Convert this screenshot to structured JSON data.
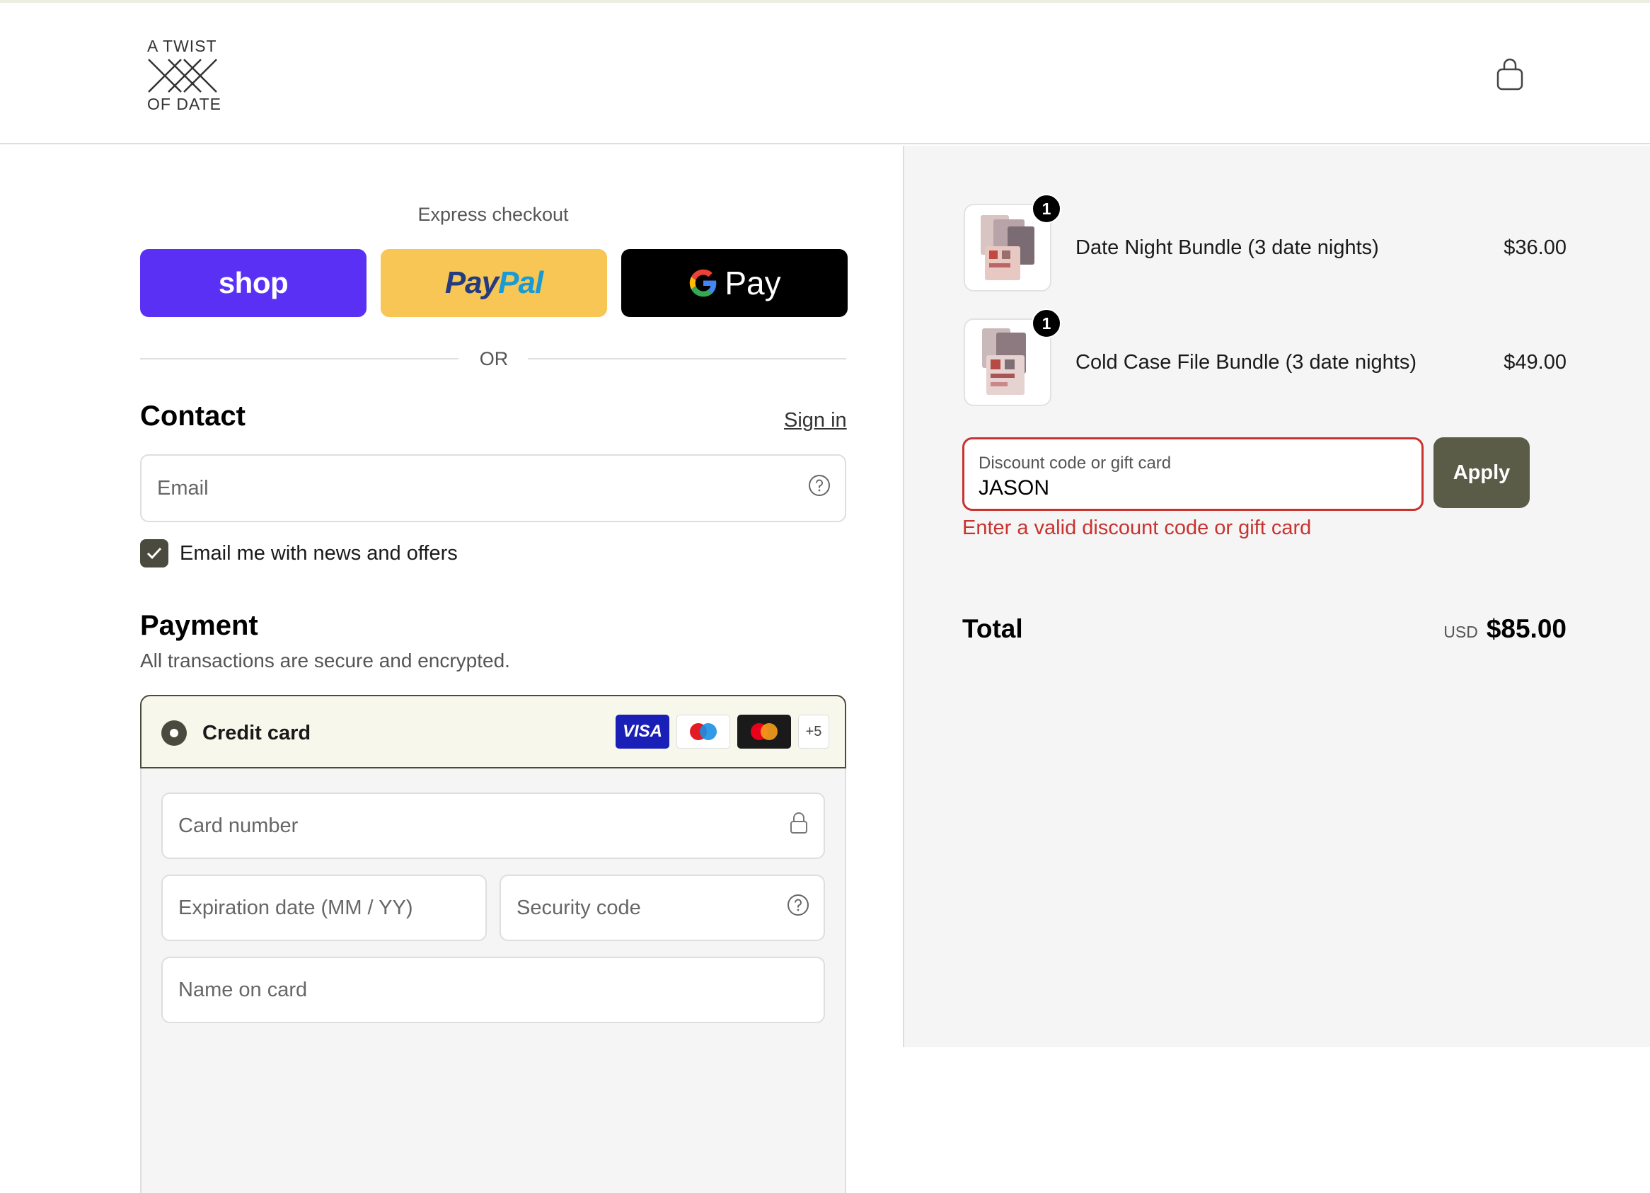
{
  "brand": {
    "logo_line1": "A TWIST",
    "logo_line2": "OF DATE"
  },
  "header": {
    "cart_icon": "shopping-bag-icon"
  },
  "express": {
    "title": "Express checkout",
    "shop_label": "shop",
    "paypal_part1": "Pay",
    "paypal_part2": "Pal",
    "gpay_label": "Pay",
    "or_label": "OR"
  },
  "contact": {
    "title": "Contact",
    "sign_in": "Sign in",
    "email_placeholder": "Email",
    "newsletter_label": "Email me with news and offers",
    "newsletter_checked": true
  },
  "payment": {
    "title": "Payment",
    "subtitle": "All transactions are secure and encrypted.",
    "method_label": "Credit card",
    "card_brands": [
      "VISA",
      "maestro",
      "mastercard"
    ],
    "more_brands": "+5",
    "card_number_placeholder": "Card number",
    "expiry_placeholder": "Expiration date (MM / YY)",
    "security_placeholder": "Security code",
    "name_placeholder": "Name on card"
  },
  "order": {
    "items": [
      {
        "name": "Date Night Bundle (3 date nights)",
        "price": "$36.00",
        "qty": "1"
      },
      {
        "name": "Cold Case File Bundle (3 date nights)",
        "price": "$49.00",
        "qty": "1"
      }
    ],
    "discount_label": "Discount code or gift card",
    "discount_value": "JASON",
    "apply_label": "Apply",
    "discount_error": "Enter a valid discount code or gift card",
    "total_label": "Total",
    "currency": "USD",
    "total_value": "$85.00"
  },
  "colors": {
    "shop": "#5a31f4",
    "paypal": "#f7c654",
    "accent": "#4a4a3e",
    "error": "#c8332f"
  }
}
